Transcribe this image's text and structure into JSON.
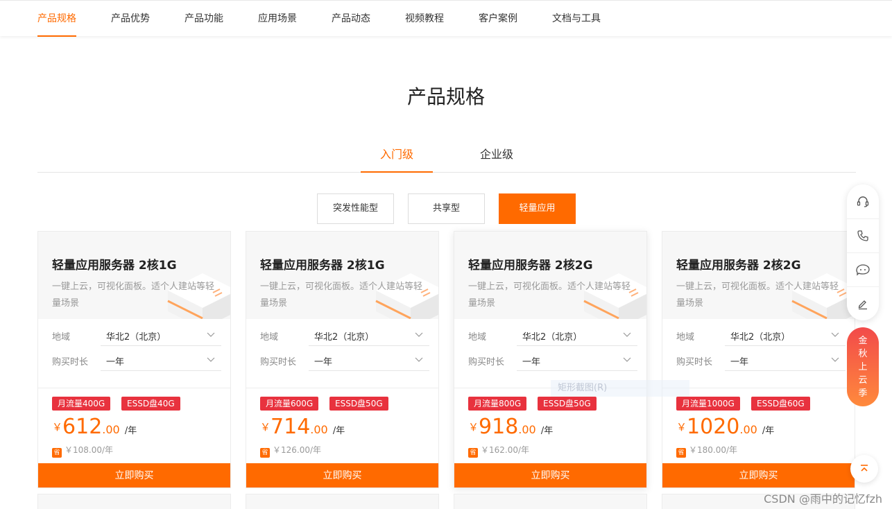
{
  "nav": {
    "items": [
      {
        "label": "产品规格",
        "active": true
      },
      {
        "label": "产品优势"
      },
      {
        "label": "产品功能"
      },
      {
        "label": "应用场景"
      },
      {
        "label": "产品动态"
      },
      {
        "label": "视频教程"
      },
      {
        "label": "客户案例"
      },
      {
        "label": "文档与工具"
      }
    ]
  },
  "section": {
    "title": "产品规格"
  },
  "level_tabs": [
    {
      "label": "入门级",
      "active": true
    },
    {
      "label": "企业级"
    }
  ],
  "type_tabs": [
    {
      "label": "突发性能型"
    },
    {
      "label": "共享型"
    },
    {
      "label": "轻量应用",
      "active": true
    }
  ],
  "spec_labels": {
    "region": "地域",
    "duration": "购买时长"
  },
  "cards": [
    {
      "title": "轻量应用服务器 2核1G",
      "desc": "一键上云，可视化面板。适个人建站等轻量场景",
      "region": "华北2（北京）",
      "duration": "一年",
      "badges": [
        "月流量400G",
        "ESSD盘40G"
      ],
      "yen": "￥",
      "price_int": "612",
      "price_dec": ".00",
      "unit": "/年",
      "save_icon": "省",
      "save": "￥108.00/年",
      "buy": "立即购买"
    },
    {
      "title": "轻量应用服务器 2核1G",
      "desc": "一键上云，可视化面板。适个人建站等轻量场景",
      "region": "华北2（北京）",
      "duration": "一年",
      "badges": [
        "月流量600G",
        "ESSD盘50G"
      ],
      "yen": "￥",
      "price_int": "714",
      "price_dec": ".00",
      "unit": "/年",
      "save_icon": "省",
      "save": "￥126.00/年",
      "buy": "立即购买"
    },
    {
      "title": "轻量应用服务器 2核2G",
      "desc": "一键上云，可视化面板。适个人建站等轻量场景",
      "region": "华北2（北京）",
      "duration": "一年",
      "badges": [
        "月流量800G",
        "ESSD盘50G"
      ],
      "yen": "￥",
      "price_int": "918",
      "price_dec": ".00",
      "unit": "/年",
      "save_icon": "省",
      "save": "￥162.00/年",
      "buy": "立即购买"
    },
    {
      "title": "轻量应用服务器 2核2G",
      "desc": "一键上云，可视化面板。适个人建站等轻量场景",
      "region": "华北2（北京）",
      "duration": "一年",
      "badges": [
        "月流量1000G",
        "ESSD盘60G"
      ],
      "yen": "￥",
      "price_int": "1020",
      "price_dec": ".00",
      "unit": "/年",
      "save_icon": "省",
      "save": "￥180.00/年",
      "buy": "立即购买"
    }
  ],
  "float_toolbar": {
    "icons": [
      "headset-icon",
      "phone-icon",
      "chat-icon",
      "edit-icon"
    ],
    "promo": "金秋上云季",
    "top_icon": "back-to-top-icon"
  },
  "ghost_tip": "矩形截图(R)",
  "watermark": "CSDN @雨中的记忆fzh",
  "colors": {
    "accent": "#ff6a00",
    "badge": "#e8323e"
  }
}
